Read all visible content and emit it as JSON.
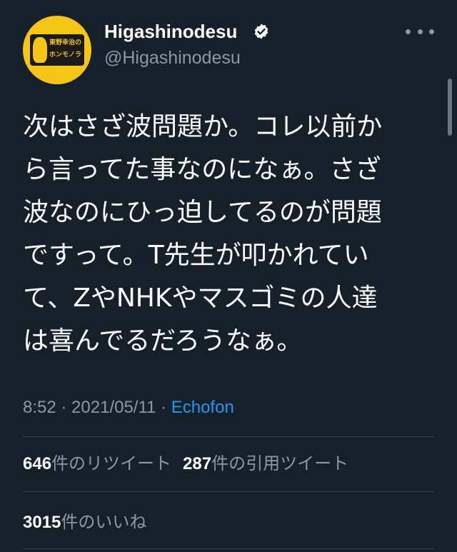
{
  "author": {
    "display_name": "Higashinodesu",
    "handle": "@Higashinodesu",
    "avatar": {
      "line1": "東野幸治の",
      "line2": "ホンモノラジオ",
      "color": "#f5c518"
    }
  },
  "tweet": {
    "lines": [
      "次はさざ波問題か。コレ以前か",
      "ら言ってた事なのになぁ。さざ",
      "波なのにひっ迫してるのが問題",
      "ですって。T先生が叩かれてい",
      "て、ZやNHKやマスゴミの人達",
      "は喜んでるだろうなぁ。"
    ]
  },
  "meta": {
    "time": "8:52",
    "sep1": " · ",
    "date": "2021/05/11",
    "sep2": " · ",
    "source": "Echofon"
  },
  "stats": {
    "retweets_count": "646",
    "retweets_label": "件のリツイート",
    "quotes_count": "287",
    "quotes_label": "件の引用ツイート",
    "likes_count": "3015",
    "likes_label": "件のいいね"
  },
  "colors": {
    "background": "#15202b",
    "secondary_text": "#8b98a5",
    "accent": "#1d9bf0",
    "divider": "#38444d"
  }
}
